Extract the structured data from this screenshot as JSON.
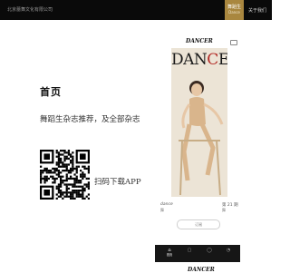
{
  "header": {
    "company": "北京蕾舞文化有限公司",
    "nav_home": "舞蹈生",
    "nav_home_sub": "Dance",
    "nav_about": "关于我们"
  },
  "main": {
    "title": "首页",
    "subtitle": "舞蹈生杂志推荐，及全部杂志",
    "scan_label": "扫码下载APP"
  },
  "phone": {
    "header_logo": "DANCER",
    "cover_title_pre": "DAN",
    "cover_title_accent": "C",
    "cover_title_post": "ER",
    "issue_name": "dance",
    "issue_sub": "舞",
    "issue_no": "第 21 期",
    "issue_no_sub": "舞",
    "subscribe_label": "订阅",
    "tabs": [
      {
        "icon": "⌂",
        "label": "首页"
      },
      {
        "icon": "▢",
        "label": ""
      },
      {
        "icon": "◯",
        "label": ""
      },
      {
        "icon": "◔",
        "label": ""
      }
    ]
  },
  "footer": {
    "logo": "DANCER"
  },
  "colors": {
    "topbar": "#0a0a0a",
    "accent_gold": "#a9873f",
    "cover_red": "#b22a25"
  },
  "icons": [
    "menu-icon",
    "home-icon",
    "magazine-icon",
    "search-icon",
    "user-icon",
    "qr-code"
  ]
}
